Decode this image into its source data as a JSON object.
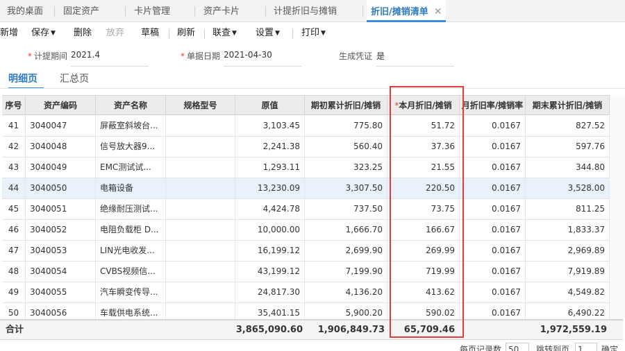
{
  "tabs": [
    {
      "label": "我的桌面"
    },
    {
      "label": "固定资产"
    },
    {
      "label": "卡片管理"
    },
    {
      "label": "资产卡片"
    },
    {
      "label": "计提折旧与摊销"
    },
    {
      "label": "折旧/摊销清单"
    }
  ],
  "toolbar": {
    "add": "新增",
    "save": "保存",
    "delete": "删除",
    "abandon": "放弃",
    "draft": "草稿",
    "refresh": "刷新",
    "query": "联查",
    "settings": "设置",
    "print": "打印"
  },
  "form": {
    "period_label": "计提期间",
    "period_value": "2021.4",
    "date_label": "单据日期",
    "date_value": "2021-04-30",
    "voucher_label": "生成凭证",
    "voucher_value": "是"
  },
  "subtabs": {
    "detail": "明细页",
    "summary": "汇总页"
  },
  "grid": {
    "columns": [
      "序号",
      "资产编码",
      "资产名称",
      "规格型号",
      "原值",
      "期初累计折旧/摊销",
      "本月折旧/摊销",
      "月折旧率/摊销率",
      "期末累计折旧/摊销"
    ],
    "rows": [
      [
        "41",
        "3040047",
        "屏蔽室斜坡台...",
        "",
        "3,103.45",
        "775.80",
        "51.72",
        "0.0167",
        "827.52"
      ],
      [
        "42",
        "3040048",
        "信号放大器9...",
        "",
        "2,241.38",
        "560.40",
        "37.36",
        "0.0167",
        "597.76"
      ],
      [
        "43",
        "3040049",
        "EMC测试试...",
        "",
        "1,293.11",
        "323.25",
        "21.55",
        "0.0167",
        "344.80"
      ],
      [
        "44",
        "3040050",
        "电箱设备",
        "",
        "13,230.09",
        "3,307.50",
        "220.50",
        "0.0167",
        "3,528.00"
      ],
      [
        "45",
        "3040051",
        "绝缘耐压测试...",
        "",
        "4,424.78",
        "737.50",
        "73.75",
        "0.0167",
        "811.25"
      ],
      [
        "46",
        "3040052",
        "电阻负载柜 D...",
        "",
        "10,000.00",
        "1,666.70",
        "166.67",
        "0.0167",
        "1,833.37"
      ],
      [
        "47",
        "3040053",
        "LIN光电收发...",
        "",
        "16,199.12",
        "2,699.90",
        "269.99",
        "0.0167",
        "2,969.89"
      ],
      [
        "48",
        "3040054",
        "CVBS视频信...",
        "",
        "43,199.12",
        "7,199.90",
        "719.99",
        "0.0167",
        "7,919.89"
      ],
      [
        "49",
        "3040055",
        "汽车瞬变传导...",
        "",
        "24,817.30",
        "4,136.20",
        "413.62",
        "0.0167",
        "4,549.82"
      ],
      [
        "50",
        "3040056",
        "车载供电系统...",
        "",
        "35,401.15",
        "5,900.20",
        "590.02",
        "0.0167",
        "6,490.22"
      ]
    ],
    "selected_row": 3
  },
  "totals": {
    "label": "合计",
    "original": "3,865,090.60",
    "opening": "1,906,849.73",
    "month": "65,709.46",
    "closing": "1,972,559.19"
  },
  "pager": {
    "per_page_label": "每页记录数",
    "per_page_value": "50",
    "jump_label": "跳转到页",
    "jump_value": "1",
    "confirm_label": "确定"
  }
}
